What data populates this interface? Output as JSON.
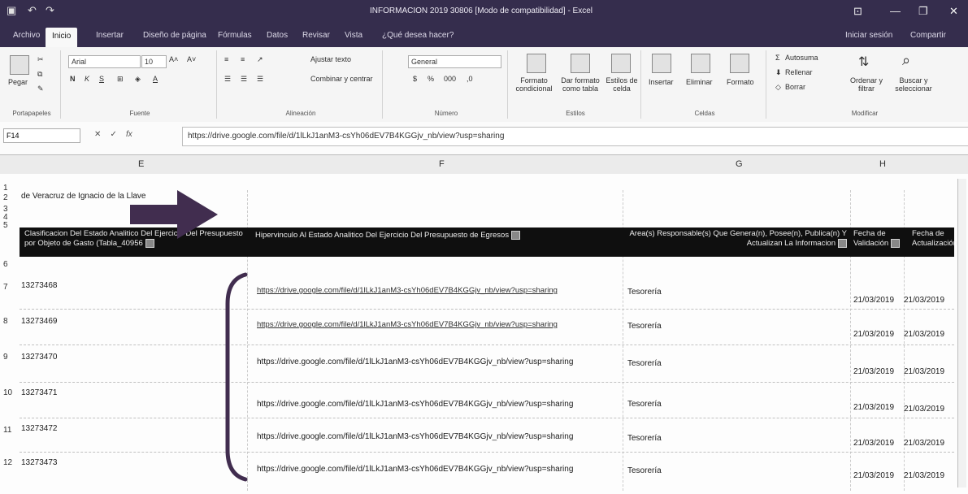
{
  "window": {
    "title": "INFORMACION 2019 30806 [Modo de compatibilidad] - Excel",
    "user": "Iniciar sesión",
    "share": "Compartir"
  },
  "tabs": [
    "Archivo",
    "Inicio",
    "Insertar",
    "Diseño de página",
    "Fórmulas",
    "Datos",
    "Revisar",
    "Vista",
    "¿Qué desea hacer?"
  ],
  "ribbon": {
    "clipboard": {
      "paste": "Pegar",
      "label": "Portapapeles"
    },
    "font": {
      "name": "Arial",
      "size": "10",
      "label": "Fuente"
    },
    "alignment": {
      "wrap": "Ajustar texto",
      "merge": "Combinar y centrar",
      "label": "Alineación"
    },
    "number": {
      "format": "General",
      "label": "Número"
    },
    "styles": {
      "conditional": "Formato condicional",
      "as_table": "Dar formato como tabla",
      "cell_styles": "Estilos de celda",
      "label": "Estilos"
    },
    "cells": {
      "insert": "Insertar",
      "delete": "Eliminar",
      "format": "Formato",
      "label": "Celdas"
    },
    "editing": {
      "autosum": "Autosuma",
      "fill": "Rellenar",
      "clear": "Borrar",
      "sort": "Ordenar y filtrar",
      "find": "Buscar y seleccionar",
      "label": "Modificar"
    }
  },
  "formula_bar": {
    "name_box": "F14",
    "formula": "https://drive.google.com/file/d/1lLkJ1anM3-csYh06dEV7B4KGGjv_nb/view?usp=sharing"
  },
  "columns": [
    "E",
    "F",
    "G",
    "H"
  ],
  "rows": {
    "r2_text": "de Veracruz de Ignacio de la Llave",
    "headers": {
      "e": "Clasificacion Del Estado Analitico Del Ejercicio Del Presupuesto por Objeto de Gasto (Tabla_40956",
      "f": "Hipervinculo Al Estado Analitico Del Ejercicio Del Presupuesto de Egresos",
      "g": "Area(s) Responsable(s) Que Genera(n), Posee(n), Publica(n) Y Actualizan La Informacion",
      "h": "Fecha de Validación",
      "i": "Fecha de Actualización"
    },
    "data": [
      {
        "num": "7",
        "e": "13273468",
        "f": "https://drive.google.com/file/d/1lLkJ1anM3-csYh06dEV7B4KGGjv_nb/view?usp=sharing",
        "g": "Tesorería",
        "h": "21/03/2019",
        "i": "21/03/2019"
      },
      {
        "num": "8",
        "e": "13273469",
        "f": "https://drive.google.com/file/d/1lLkJ1anM3-csYh06dEV7B4KGGjv_nb/view?usp=sharing",
        "g": "Tesorería",
        "h": "21/03/2019",
        "i": "21/03/2019"
      },
      {
        "num": "9",
        "e": "13273470",
        "f": "https://drive.google.com/file/d/1lLkJ1anM3-csYh06dEV7B4KGGjv_nb/view?usp=sharing",
        "g": "Tesorería",
        "h": "21/03/2019",
        "i": "21/03/2019"
      },
      {
        "num": "10",
        "e": "13273471",
        "f": "https://drive.google.com/file/d/1lLkJ1anM3-csYh06dEV7B4KGGjv_nb/view?usp=sharing",
        "g": "Tesorería",
        "h": "21/03/2019",
        "i": "21/03/2019"
      },
      {
        "num": "11",
        "e": "13273472",
        "f": "https://drive.google.com/file/d/1lLkJ1anM3-csYh06dEV7B4KGGjv_nb/view?usp=sharing",
        "g": "Tesorería",
        "h": "21/03/2019",
        "i": "21/03/2019"
      },
      {
        "num": "12",
        "e": "13273473",
        "f": "https://drive.google.com/file/d/1lLkJ1anM3-csYh06dEV7B4KGGjv_nb/view?usp=sharing",
        "g": "Tesorería",
        "h": "21/03/2019",
        "i": "21/03/2019"
      }
    ]
  },
  "colors": {
    "title_bar": "#3b2f5e",
    "annotation": "#4a2e5f",
    "header_band": "#141414"
  }
}
